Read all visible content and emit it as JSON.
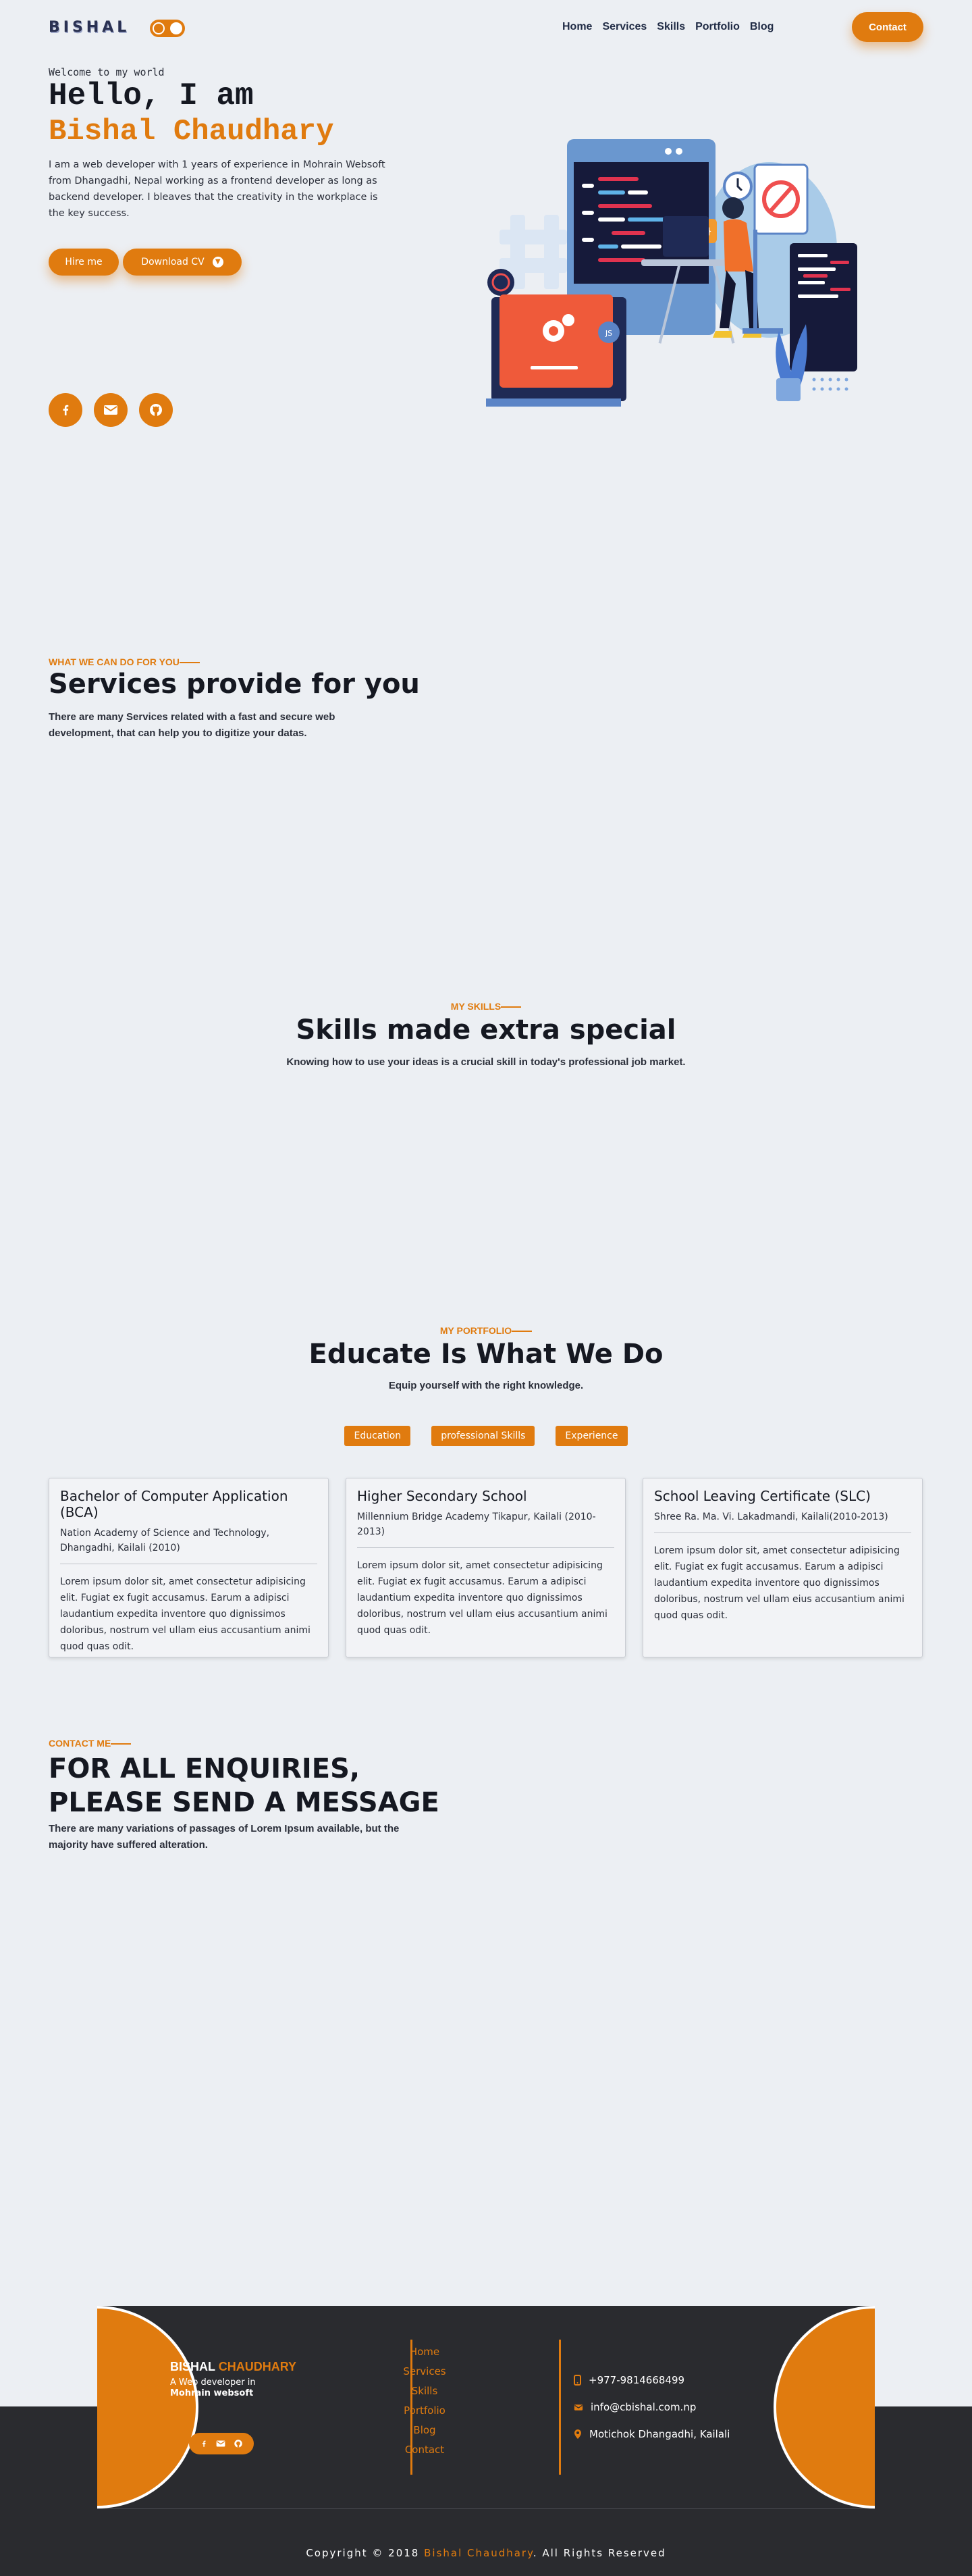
{
  "nav": {
    "logo": "BISHAL",
    "menu": [
      "Home",
      "Services",
      "Skills",
      "Portfolio",
      "Blog"
    ],
    "contact_label": "Contact"
  },
  "hero": {
    "welcome": "Welcome to my world",
    "hello": "Hello, I am",
    "name": "Bishal Chaudhary",
    "description": "I am a web developer with 1 years of experience in Mohrain Websoft from Dhangadhi, Nepal working as a frontend developer as long as backend developer. I bleaves that the creativity in the workplace is the key success.",
    "hire_label": "Hire me",
    "cv_label": "Download CV",
    "socials": [
      "facebook-icon",
      "envelope-icon",
      "github-icon"
    ]
  },
  "services": {
    "tag": "WHAT WE CAN DO FOR YOU",
    "title": "Services provide for you",
    "subtitle": "There are many Services related with a fast and secure web development, that can help you to digitize your datas."
  },
  "skills": {
    "tag": "MY SKILLS",
    "title": "Skills made extra special",
    "subtitle": "Knowing how to use your ideas is a crucial skill in today's professional job market."
  },
  "portfolio": {
    "tag": "MY PORTFOLIO",
    "title": "Educate Is What We Do",
    "subtitle": "Equip yourself with the right knowledge.",
    "filters": [
      "Education",
      "professional Skills",
      "Experience"
    ],
    "cards": [
      {
        "title": "Bachelor of Computer Application (BCA)",
        "institution": "Nation Academy of Science and Technology, Dhangadhi, Kailali (2010)",
        "body": "Lorem ipsum dolor sit, amet consectetur adipisicing elit. Fugiat ex fugit accusamus. Earum a adipisci laudantium expedita inventore quo dignissimos doloribus, nostrum vel ullam eius accusantium animi quod quas odit."
      },
      {
        "title": "Higher Secondary School",
        "institution": "Millennium Bridge Academy Tikapur, Kailali (2010-2013)",
        "body": "Lorem ipsum dolor sit, amet consectetur adipisicing elit. Fugiat ex fugit accusamus. Earum a adipisci laudantium expedita inventore quo dignissimos doloribus, nostrum vel ullam eius accusantium animi quod quas odit."
      },
      {
        "title": "School Leaving Certificate (SLC)",
        "institution": "Shree Ra. Ma. Vi. Lakadmandi, Kailali(2010-2013)",
        "body": "Lorem ipsum dolor sit, amet consectetur adipisicing elit. Fugiat ex fugit accusamus. Earum a adipisci laudantium expedita inventore quo dignissimos doloribus, nostrum vel ullam eius accusantium animi quod quas odit."
      }
    ]
  },
  "contact": {
    "tag": "CONTACT ME",
    "title": "FOR ALL ENQUIRIES, PLEASE SEND A MESSAGE",
    "subtitle": "There are many variations of passages of Lorem Ipsum available, but the majority have suffered alteration."
  },
  "footer": {
    "brand_first": "BISHAL",
    "brand_last": "CHAUDHARY",
    "tagline": "A Web developer in",
    "company": "Mohrain websoft",
    "links": [
      "Home",
      "Services",
      "Skills",
      "Portfolio",
      "Blog",
      "Contact"
    ],
    "phone": "+977-9814668499",
    "email": "info@cbishal.com.np",
    "address": "Motichok Dhangadhi, Kailali",
    "copyright_prefix": "Copyright © 2018",
    "copyright_name": "Bishal Chaudhary",
    "copyright_suffix": ". All Rights Reserved"
  },
  "colors": {
    "accent": "#e07b0f",
    "background": "#eceff3",
    "footer": "#2a2b2f",
    "navy": "#1f2a44"
  }
}
